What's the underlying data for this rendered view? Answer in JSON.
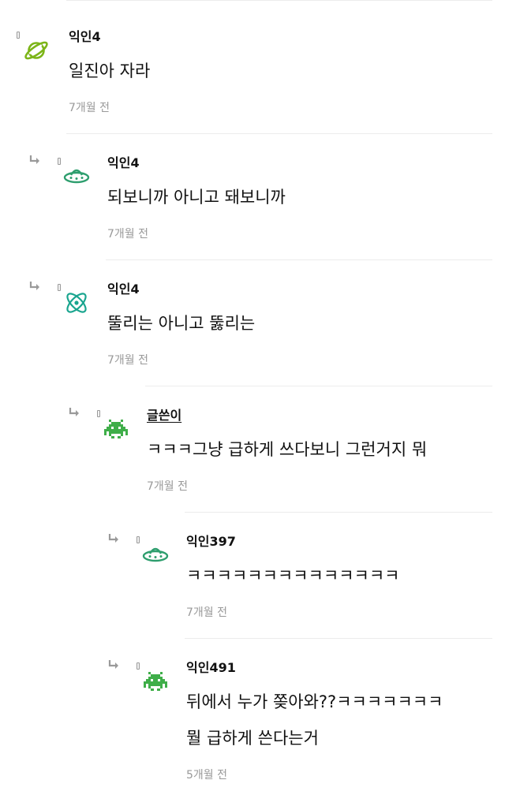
{
  "comments": [
    {
      "nick": "익인4",
      "avatar": "planet-icon",
      "is_reply": false,
      "is_author": false,
      "lines": [
        "일진아 자라"
      ],
      "time": "7개월 전"
    },
    {
      "nick": "익인4",
      "avatar": "ufo-icon",
      "is_reply": true,
      "is_author": false,
      "lines": [
        "되보니까 아니고 돼보니까"
      ],
      "time": "7개월 전"
    },
    {
      "nick": "익인4",
      "avatar": "atom-icon",
      "is_reply": true,
      "is_author": false,
      "lines": [
        "뚤리는 아니고 뚫리는"
      ],
      "time": "7개월 전"
    },
    {
      "nick": "글쓴이",
      "avatar": "space-invader-icon",
      "is_reply": true,
      "is_author": true,
      "lines": [
        "ㅋㅋㅋ그냥 급하게 쓰다보니 그런거지 뭐"
      ],
      "time": "7개월 전"
    },
    {
      "nick": "익인397",
      "avatar": "ufo-icon",
      "is_reply": true,
      "is_author": false,
      "lines": [
        "ㅋㅋㅋㅋㅋㅋㅋㅋㅋㅋㅋㅋㅋㅋ"
      ],
      "time": "7개월 전"
    },
    {
      "nick": "익인491",
      "avatar": "space-invader-icon",
      "is_reply": true,
      "is_author": false,
      "lines": [
        "뒤에서 누가 쫒아와??ㅋㅋㅋㅋㅋㅋㅋ",
        "뭘 급하게 쓴다는거"
      ],
      "time": "5개월 전"
    }
  ],
  "colors": {
    "planet": "#7cb518",
    "ufo": "#2e9e6e",
    "atom": "#1aa58f",
    "invader": "#3fae49",
    "reply_arrow": "#9a9a9a",
    "time": "#999999",
    "divider": "#ececec"
  }
}
